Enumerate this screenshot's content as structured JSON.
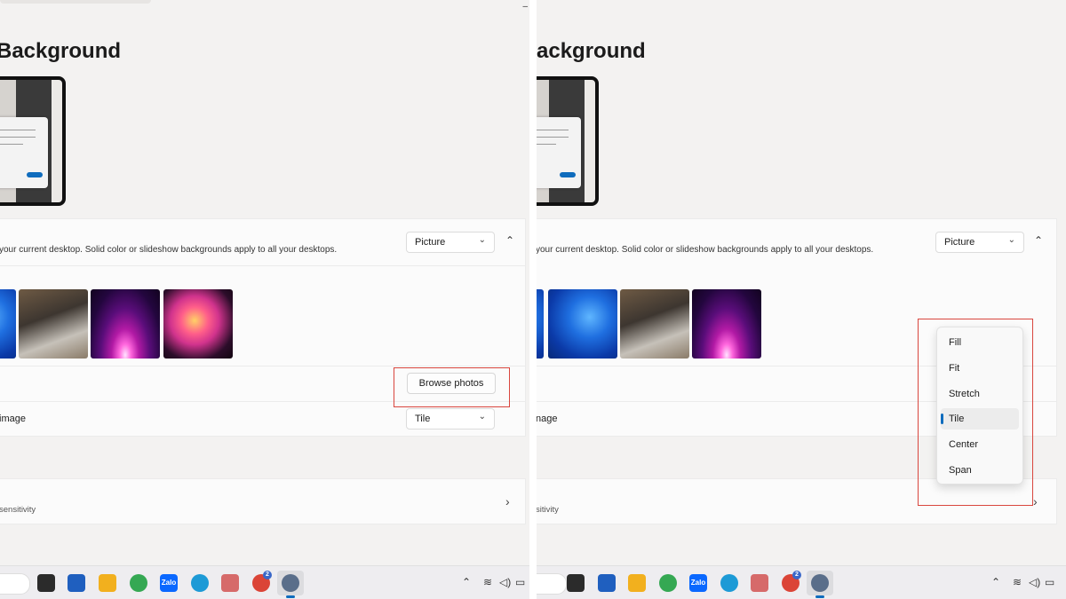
{
  "left": {
    "title": "Background",
    "personalize_description": "your current desktop. Solid color or slideshow backgrounds apply to all your desktops.",
    "personalize_value": "Picture",
    "browse_label": "Browse photos",
    "fit_label": "image",
    "fit_value": "Tile",
    "contrast_subtext": "sensitivity"
  },
  "right": {
    "title": "ackground",
    "personalize_description": "your current desktop. Solid color or slideshow backgrounds apply to all your desktops.",
    "personalize_value": "Picture",
    "fit_label": "nage",
    "contrast_subtext": "sitivity",
    "fit_options": [
      "Fill",
      "Fit",
      "Stretch",
      "Tile",
      "Center",
      "Span"
    ],
    "selected_fit": "Tile"
  },
  "taskbar": {
    "zalo_label": "Zalo",
    "chrome_badge": "2"
  },
  "icons": {
    "minimize": "minimize-icon",
    "chevron_down": "chevron-down-icon",
    "chevron_up": "chevron-up-icon",
    "chevron_right": "chevron-right-icon",
    "wifi": "wifi-icon",
    "volume": "volume-icon",
    "battery": "battery-icon"
  },
  "colors": {
    "accent": "#0f6cbd",
    "highlight_box": "#d9463e"
  }
}
